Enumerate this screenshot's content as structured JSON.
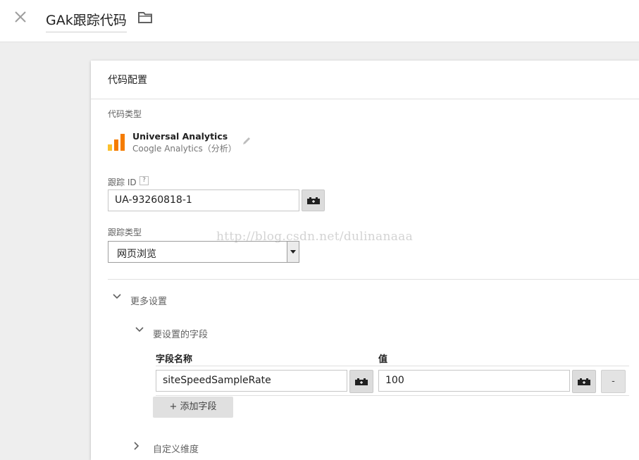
{
  "header": {
    "title": "GAk跟踪代码",
    "close_icon": "close-icon",
    "folder_icon": "folder-icon"
  },
  "card": {
    "title": "代码配置",
    "tag_type": {
      "label": "代码类型",
      "name": "Universal Analytics",
      "subtitle": "Coogle Analytics（分析）",
      "logo_icon": "analytics-bar-logo",
      "edit_icon": "pencil-icon"
    },
    "tracking_id": {
      "label": "跟踪 ID",
      "help": "?",
      "value": "UA-93260818-1"
    },
    "track_type": {
      "label": "跟踪类型",
      "selected": "网页浏览"
    },
    "more_settings": {
      "label": "更多设置",
      "fields_to_set": {
        "label": "要设置的字段",
        "col_field_name": "字段名称",
        "col_value": "值",
        "rows": [
          {
            "field_name": "siteSpeedSampleRate",
            "value": "100",
            "remove_label": "-"
          }
        ],
        "add_button": "+ 添加字段"
      },
      "custom_dimensions": {
        "label": "自定义维度"
      }
    }
  },
  "watermark": "http://blog.csdn.net/dulinanaaa",
  "colors": {
    "background": "#eeeeee",
    "card": "#ffffff",
    "logo_orange": "#f57c00",
    "logo_yellow": "#fbc02d",
    "button_gray": "#e0e0e0"
  }
}
